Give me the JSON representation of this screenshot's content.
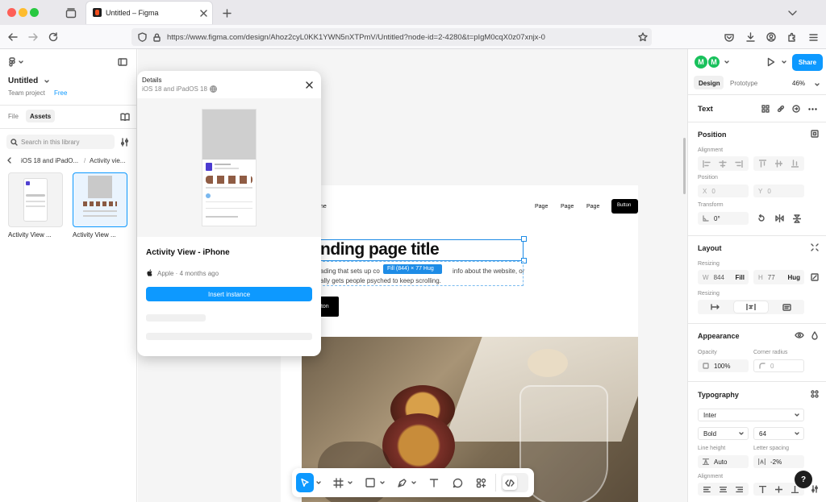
{
  "browser": {
    "tab_title": "Untitled – Figma",
    "url": "https://www.figma.com/design/Ahoz2cyL0KK1YWN5nXTPmV/Untitled?node-id=2-4280&t=pIgM0cqX0z07xnjx-0"
  },
  "file": {
    "name": "Untitled",
    "team": "Team project",
    "plan_badge": "Free",
    "tabs": [
      "File",
      "Assets"
    ],
    "search_placeholder": "Search in this library",
    "breadcrumb_lib": "iOS 18 and iPadO...",
    "breadcrumb_sep": "/",
    "breadcrumb_item": "Activity vie...",
    "components": [
      "Activity View ...",
      "Activity View ..."
    ]
  },
  "details": {
    "title": "Details",
    "subtitle": "iOS 18 and iPadOS 18",
    "component_name": "Activity View - iPhone",
    "meta": "Apple · 4 months ago",
    "insert_label": "Insert instance"
  },
  "frame": {
    "logo_fragment": "ne",
    "nav": [
      "Page",
      "Page",
      "Page"
    ],
    "nav_button": "Button",
    "heading": "nding page title",
    "subtext_line1": "ading that sets up co",
    "subtext_line1b": "info about the website, or",
    "subtext_line2": "ally gets people psyched to keep scrolling.",
    "cta": "tton",
    "size_badge": "Fill (844) × 77 Hug"
  },
  "right_panel": {
    "avatar_initial": "M",
    "share_label": "Share",
    "tabs": [
      "Design",
      "Prototype"
    ],
    "zoom": "46%",
    "layer_type": "Text",
    "position": {
      "title": "Position",
      "alignment_label": "Alignment",
      "position_label": "Position",
      "x_label": "X",
      "x_value": "0",
      "y_label": "Y",
      "y_value": "0",
      "transform_label": "Transform",
      "rotation": "0°"
    },
    "layout": {
      "title": "Layout",
      "resizing_label": "Resizing",
      "w_label": "W",
      "w_value": "844",
      "w_mode": "Fill",
      "h_label": "H",
      "h_value": "77",
      "h_mode": "Hug",
      "resizing_label2": "Resizing"
    },
    "appearance": {
      "title": "Appearance",
      "opacity_label": "Opacity",
      "opacity": "100%",
      "radius_label": "Corner radius",
      "radius": "0"
    },
    "typography": {
      "title": "Typography",
      "font": "Inter",
      "weight": "Bold",
      "size": "64",
      "line_height_label": "Line height",
      "line_height": "Auto",
      "letter_spacing_label": "Letter spacing",
      "letter_spacing": "-2%",
      "alignment_label": "Alignment"
    },
    "help": "?"
  },
  "colors": {
    "accent": "#0d99ff",
    "selection": "#1e8ce6",
    "avatar": "#19c15c"
  }
}
